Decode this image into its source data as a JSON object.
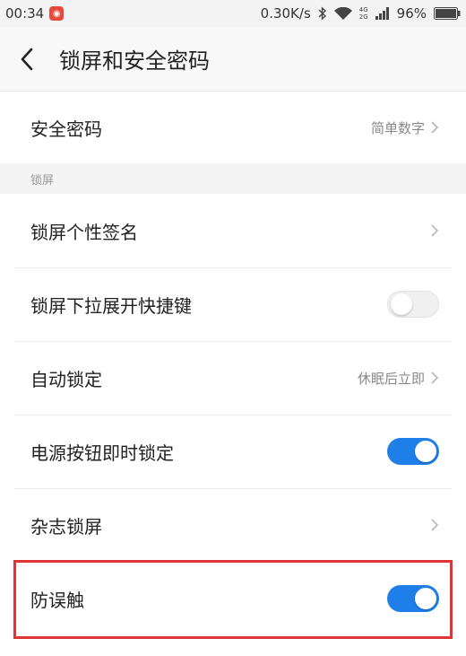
{
  "status_bar": {
    "time": "00:34",
    "speed": "0.30K/s",
    "net_top": "4G",
    "net_bottom": "2G",
    "battery": "96%",
    "icons": [
      "app-notification-icon",
      "bluetooth-icon",
      "wifi-icon",
      "cellular-signal-icon",
      "battery-icon"
    ]
  },
  "header": {
    "title": "锁屏和安全密码"
  },
  "security": {
    "label": "安全密码",
    "value": "简单数字"
  },
  "section_lock": {
    "label": "锁屏"
  },
  "items": [
    {
      "label": "锁屏个性签名"
    },
    {
      "label": "锁屏下拉展开快捷键",
      "toggle": "off"
    },
    {
      "label": "自动锁定",
      "value": "休眠后立即"
    },
    {
      "label": "电源按钮即时锁定",
      "toggle": "on"
    },
    {
      "label": "杂志锁屏"
    },
    {
      "label": "防误触",
      "toggle": "on"
    }
  ],
  "colors": {
    "accent": "#1f7fe8",
    "highlight": "#e03535"
  }
}
